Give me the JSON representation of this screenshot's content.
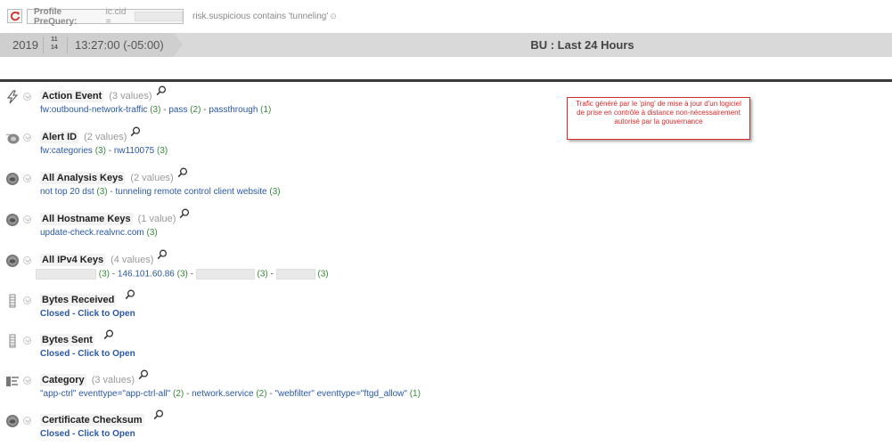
{
  "query_bar": {
    "profile_label": "Profile PreQuery:",
    "profile_value": "ic.cid =",
    "query": "risk.suspicious contains 'tunneling'"
  },
  "time_bar": {
    "year": "2019",
    "month": "11",
    "day": "14",
    "time": "13:27:00 (-05:00)",
    "range_title": "BU : Last 24 Hours"
  },
  "annotation": {
    "text": "Trafic généré par le 'ping' de mise à jour d'un logiciel de prise en contrôle à distance non-nécessairement autorisé par la gouvernance"
  },
  "meta": [
    {
      "title": "Action Event",
      "count": "(3 values)",
      "icon": "lightning-icon",
      "values": [
        {
          "text": "fw:outbound-network-traffic",
          "count": "(3)"
        },
        {
          "text": "pass",
          "count": "(2)"
        },
        {
          "text": "passthrough",
          "count": "(1)"
        }
      ]
    },
    {
      "title": "Alert ID",
      "count": "(2 values)",
      "icon": "alert-disc-icon",
      "values": [
        {
          "text": "fw:categories",
          "count": "(3)"
        },
        {
          "text": "nw110075",
          "count": "(3)"
        }
      ]
    },
    {
      "title": "All Analysis Keys",
      "count": "(2 values)",
      "icon": "disc-icon",
      "values": [
        {
          "text": "not top 20 dst",
          "count": "(3)"
        },
        {
          "text": "tunneling remote control client website",
          "count": "(3)"
        }
      ]
    },
    {
      "title": "All Hostname Keys",
      "count": "(1 value)",
      "icon": "disc-icon",
      "values": [
        {
          "text": "update-check.realvnc.com",
          "count": "(3)"
        }
      ]
    },
    {
      "title": "All IPv4 Keys",
      "count": "(4 values)",
      "icon": "disc-icon",
      "values": [
        {
          "text": "",
          "count": "(3)"
        },
        {
          "text": "146.101.60.86",
          "count": "(3)"
        },
        {
          "text": "",
          "count": "(3)"
        },
        {
          "text": "",
          "count": "(3)"
        }
      ]
    },
    {
      "title": "Bytes Received",
      "count": "",
      "icon": "bar-meter-icon",
      "closed": "Closed - Click to Open"
    },
    {
      "title": "Bytes Sent",
      "count": "",
      "icon": "bar-meter-icon",
      "closed": "Closed - Click to Open"
    },
    {
      "title": "Category",
      "count": "(3 values)",
      "icon": "list-icon",
      "values": [
        {
          "text": "\"app-ctrl\" eventtype=\"app-ctrl-all\"",
          "count": "(2)"
        },
        {
          "text": "network.service",
          "count": "(2)"
        },
        {
          "text": "\"webfilter\" eventtype=\"ftgd_allow\"",
          "count": "(1)"
        }
      ]
    },
    {
      "title": "Certificate Checksum",
      "count": "",
      "icon": "disc-icon",
      "closed": "Closed - Click to Open"
    }
  ]
}
